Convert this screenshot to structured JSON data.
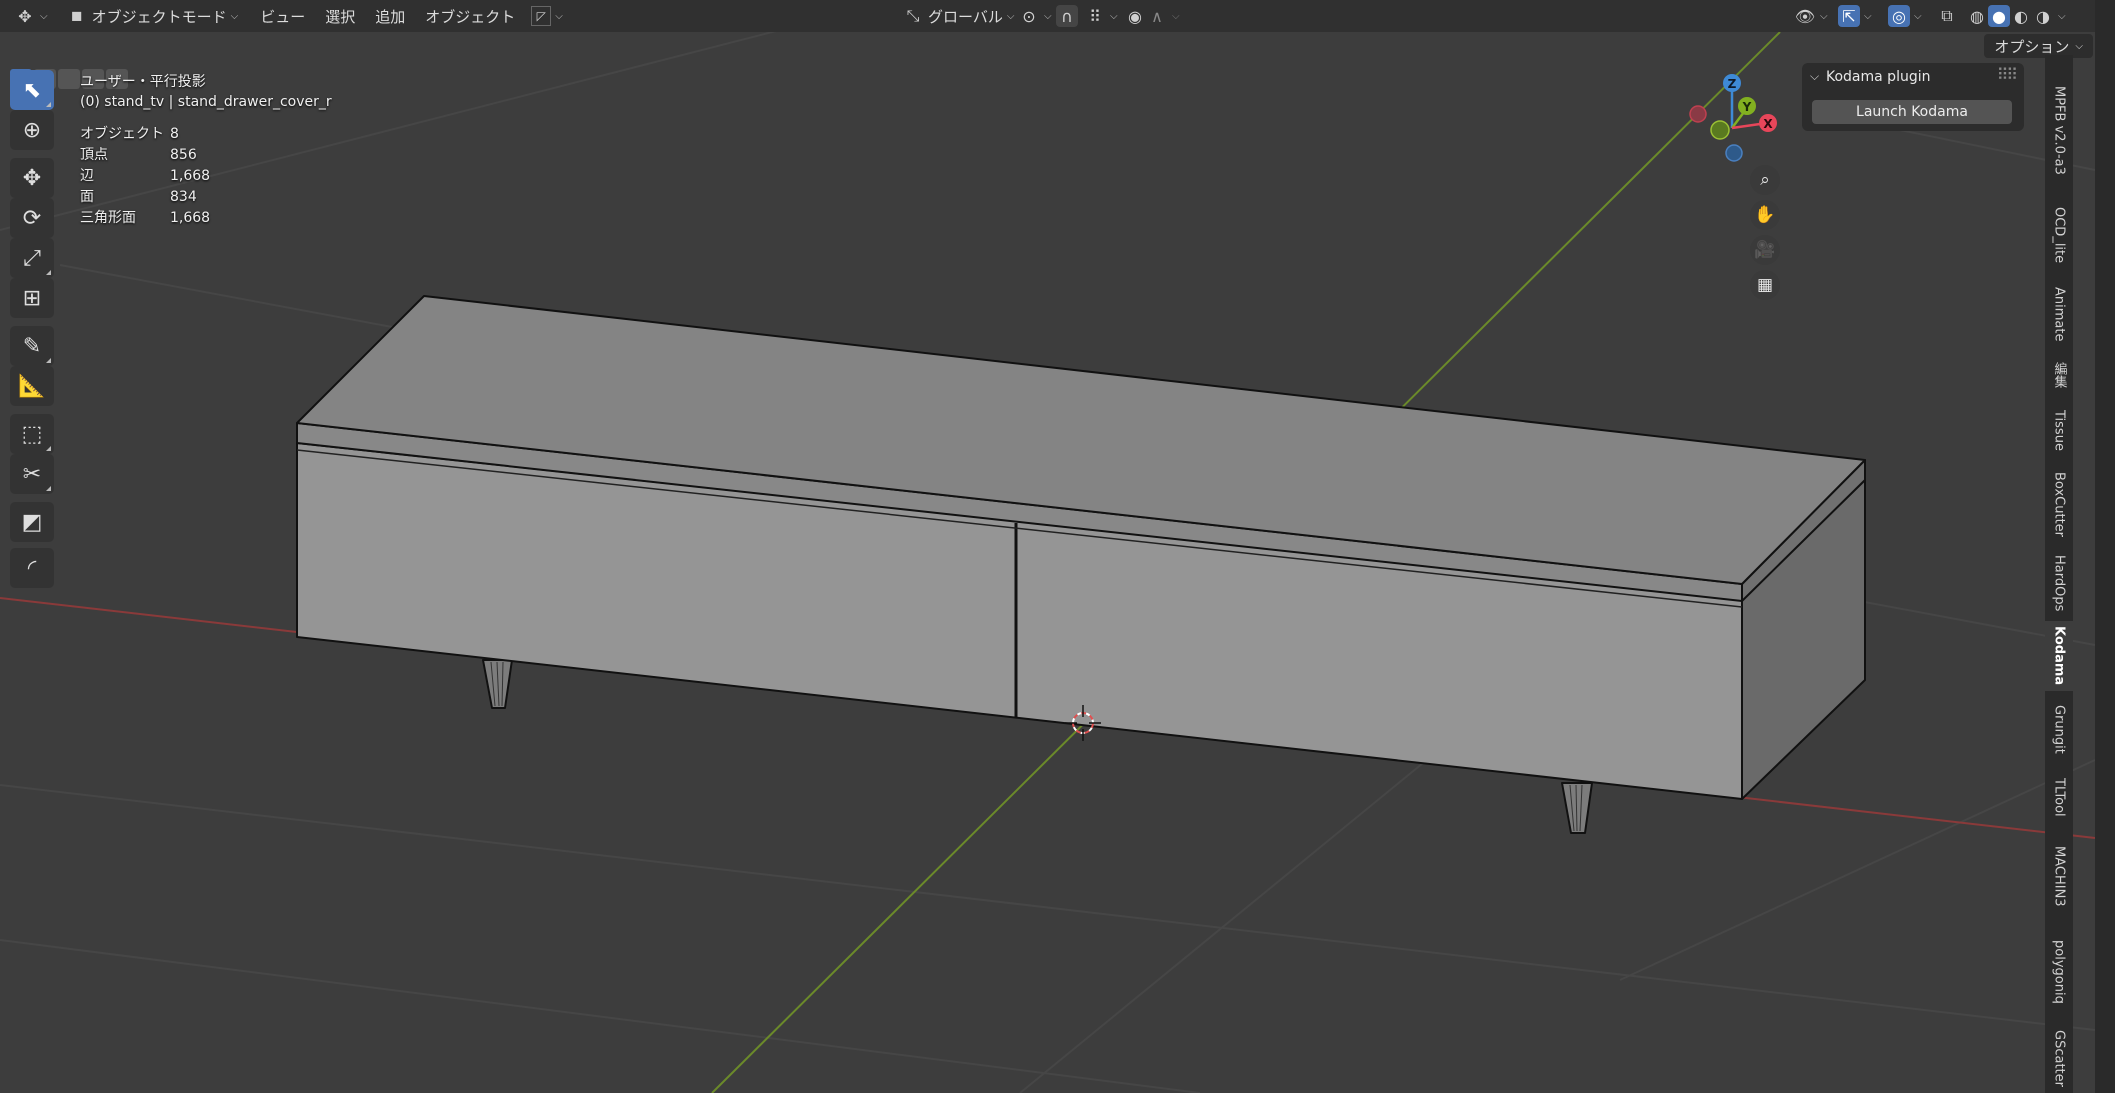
{
  "header": {
    "mode_label": "オブジェクトモード",
    "menu": [
      "ビュー",
      "選択",
      "追加",
      "オブジェクト"
    ],
    "transform_orientation": "グローバル"
  },
  "subheader": {
    "options_label": "オプション"
  },
  "overlay": {
    "view_name": "ユーザー・平行投影",
    "object_info": "(0) stand_tv | stand_drawer_cover_r",
    "stats": [
      {
        "label": "オブジェクト",
        "value": "8"
      },
      {
        "label": "頂点",
        "value": "856"
      },
      {
        "label": "辺",
        "value": "1,668"
      },
      {
        "label": "面",
        "value": "834"
      },
      {
        "label": "三角形面",
        "value": "1,668"
      }
    ]
  },
  "plugin_panel": {
    "title": "Kodama plugin",
    "button_label": "Launch Kodama"
  },
  "gizmo": {
    "x_label": "X",
    "y_label": "Y",
    "z_label": "Z"
  },
  "sidebar_tabs": [
    "MPFB v2.0-a3",
    "OCD_lite",
    "Animate",
    "編集",
    "Tissue",
    "BoxCutter",
    "HardOps",
    "Kodama",
    "Grungit",
    "TLTool",
    "MACHIN3",
    "polygoniq",
    "GScatter"
  ],
  "active_tab": "Kodama",
  "colors": {
    "accent": "#4772b3",
    "axis_x": "#e8465a",
    "axis_y": "#82b020",
    "axis_z": "#3e8ad6"
  }
}
